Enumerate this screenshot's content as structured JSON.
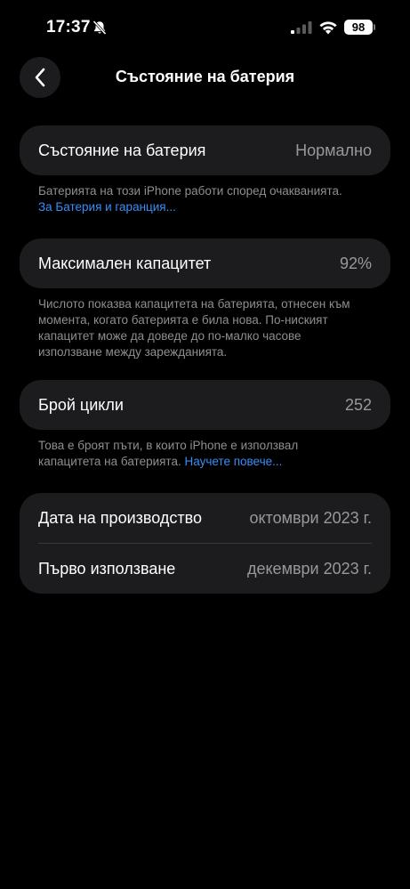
{
  "status_bar": {
    "time": "17:37",
    "battery_level": "98",
    "icons": [
      "bell-slash-icon",
      "cellular-signal-icon",
      "wifi-icon"
    ]
  },
  "nav": {
    "back_icon": "chevron-left-icon",
    "title": "Състояние на батерия"
  },
  "battery_health": {
    "label": "Състояние на батерия",
    "value": "Нормално",
    "footnote_text": "Батерията на този iPhone работи според очакванията. ",
    "footnote_link": "За Батерия и гаранция..."
  },
  "max_capacity": {
    "label": "Максимален капацитет",
    "value": "92%",
    "footnote_text": "Числото показва капацитета на батерията, отнесен към момента, когато батерията е била нова. По-ниският капацитет може да доведе до по-малко часове използване между зарежданията."
  },
  "cycle_count": {
    "label": "Брой цикли",
    "value": "252",
    "footnote_text": "Това е броят пъти, в които iPhone е използвал капацитета на батерията. ",
    "footnote_link": "Научете повече..."
  },
  "dates": {
    "manufacture_label": "Дата на производство",
    "manufacture_value": "октомври 2023 г.",
    "first_use_label": "Първо използване",
    "first_use_value": "декември 2023 г."
  },
  "colors": {
    "background": "#000000",
    "card": "#1c1c1e",
    "secondary_text": "#98989d",
    "footnote": "#8e8e93",
    "link": "#3a8df5"
  }
}
